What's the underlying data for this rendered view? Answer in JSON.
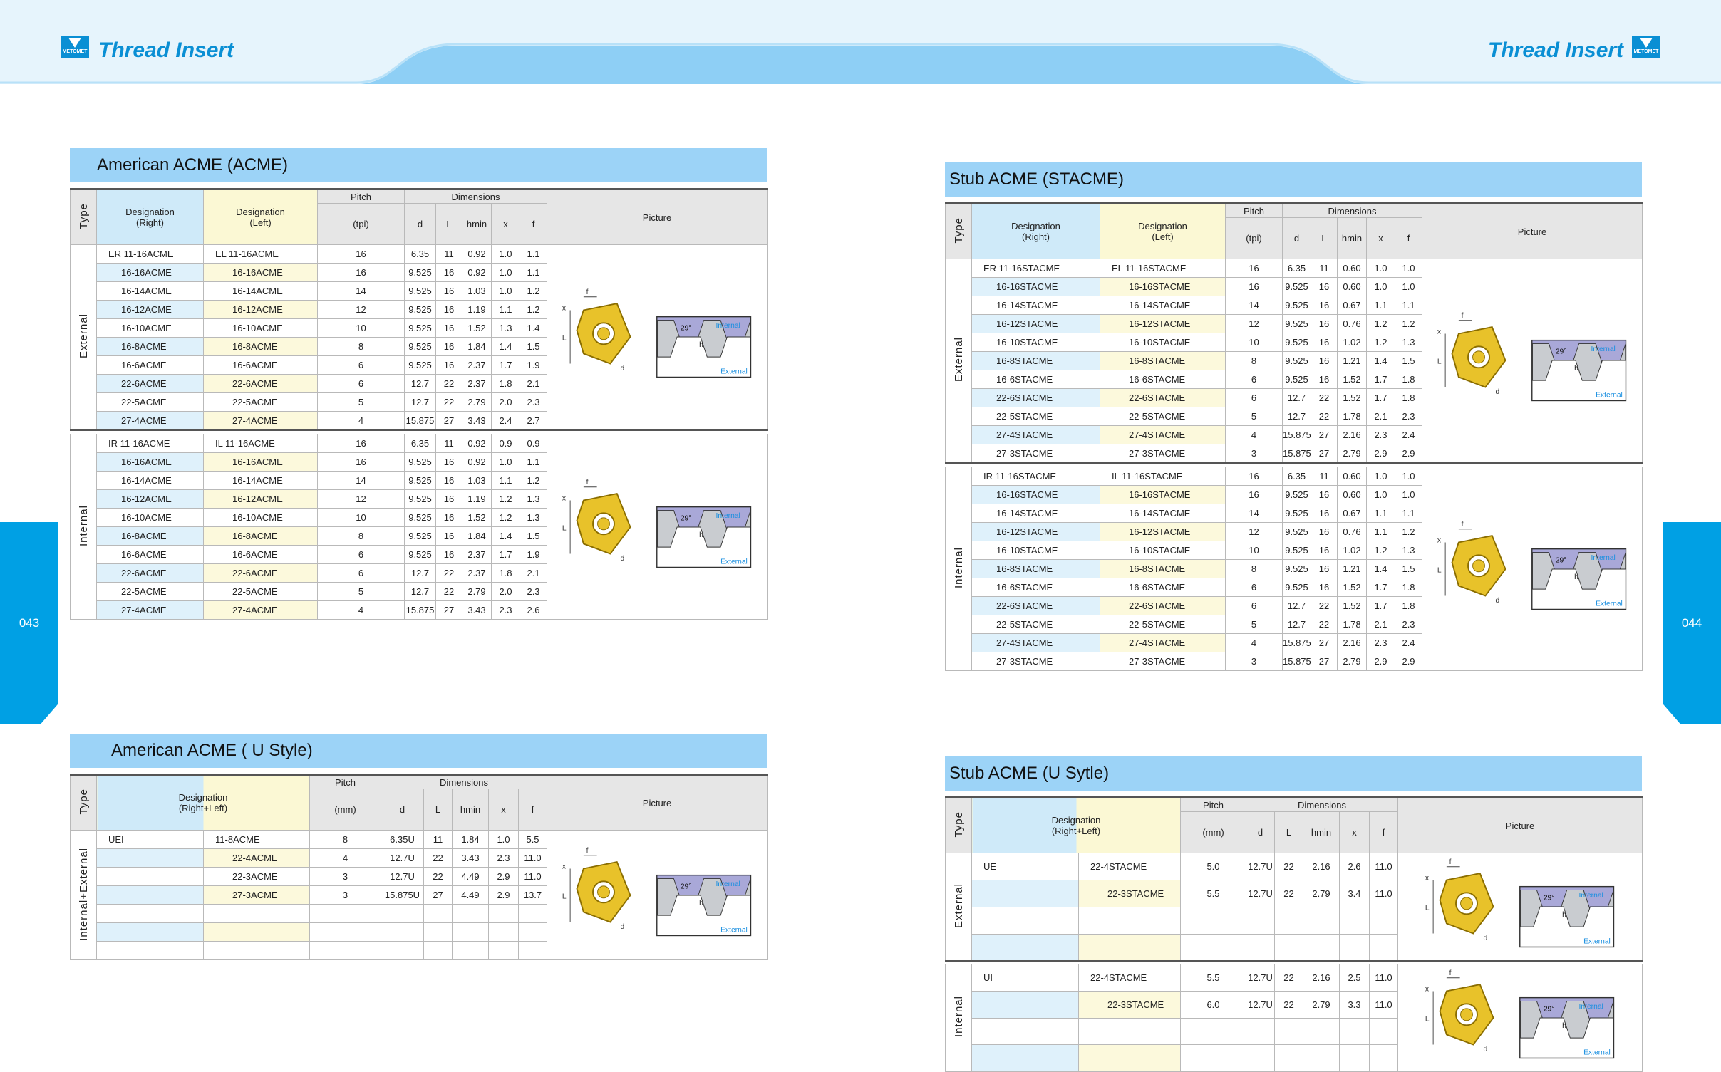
{
  "header": {
    "title_left": "Thread  Insert",
    "title_right": "Thread  Insert",
    "logo_text": "METOMET"
  },
  "side_tabs": {
    "left": "043",
    "right": "044"
  },
  "colors": {
    "accent": "#00a0e4",
    "section_header": "#9cd3f7",
    "right_col": "#dff1fb",
    "left_col": "#fcf9dc"
  },
  "labels": {
    "type": "Type",
    "des_right": "Designation\n(Right)",
    "des_left": "Designation\n(Left)",
    "des_rl": "Designation\n(Right+Left)",
    "pitch": "Pitch",
    "tpi": "(tpi)",
    "mm": "(mm)",
    "dimensions": "Dimensions",
    "d": "d",
    "L": "L",
    "hmin": "hmin",
    "x": "x",
    "f": "f",
    "picture": "Picture",
    "external": "External",
    "internal": "Internal",
    "internal_external": "Internal+External"
  },
  "acme": {
    "title": "American  ACME (ACME)",
    "external": [
      [
        "ER 11-16ACME",
        "EL 11-16ACME",
        "16",
        "6.35",
        "11",
        "0.92",
        "1.0",
        "1.1"
      ],
      [
        "16-16ACME",
        "16-16ACME",
        "16",
        "9.525",
        "16",
        "0.92",
        "1.0",
        "1.1"
      ],
      [
        "16-14ACME",
        "16-14ACME",
        "14",
        "9.525",
        "16",
        "1.03",
        "1.0",
        "1.2"
      ],
      [
        "16-12ACME",
        "16-12ACME",
        "12",
        "9.525",
        "16",
        "1.19",
        "1.1",
        "1.2"
      ],
      [
        "16-10ACME",
        "16-10ACME",
        "10",
        "9.525",
        "16",
        "1.52",
        "1.3",
        "1.4"
      ],
      [
        "16-8ACME",
        "16-8ACME",
        "8",
        "9.525",
        "16",
        "1.84",
        "1.4",
        "1.5"
      ],
      [
        "16-6ACME",
        "16-6ACME",
        "6",
        "9.525",
        "16",
        "2.37",
        "1.7",
        "1.9"
      ],
      [
        "22-6ACME",
        "22-6ACME",
        "6",
        "12.7",
        "22",
        "2.37",
        "1.8",
        "2.1"
      ],
      [
        "22-5ACME",
        "22-5ACME",
        "5",
        "12.7",
        "22",
        "2.79",
        "2.0",
        "2.3"
      ],
      [
        "27-4ACME",
        "27-4ACME",
        "4",
        "15.875",
        "27",
        "3.43",
        "2.4",
        "2.7"
      ]
    ],
    "internal": [
      [
        "IR 11-16ACME",
        "IL  11-16ACME",
        "16",
        "6.35",
        "11",
        "0.92",
        "0.9",
        "0.9"
      ],
      [
        "16-16ACME",
        "16-16ACME",
        "16",
        "9.525",
        "16",
        "0.92",
        "1.0",
        "1.1"
      ],
      [
        "16-14ACME",
        "16-14ACME",
        "14",
        "9.525",
        "16",
        "1.03",
        "1.1",
        "1.2"
      ],
      [
        "16-12ACME",
        "16-12ACME",
        "12",
        "9.525",
        "16",
        "1.19",
        "1.2",
        "1.3"
      ],
      [
        "16-10ACME",
        "16-10ACME",
        "10",
        "9.525",
        "16",
        "1.52",
        "1.2",
        "1.3"
      ],
      [
        "16-8ACME",
        "16-8ACME",
        "8",
        "9.525",
        "16",
        "1.84",
        "1.4",
        "1.5"
      ],
      [
        "16-6ACME",
        "16-6ACME",
        "6",
        "9.525",
        "16",
        "2.37",
        "1.7",
        "1.9"
      ],
      [
        "22-6ACME",
        "22-6ACME",
        "6",
        "12.7",
        "22",
        "2.37",
        "1.8",
        "2.1"
      ],
      [
        "22-5ACME",
        "22-5ACME",
        "5",
        "12.7",
        "22",
        "2.79",
        "2.0",
        "2.3"
      ],
      [
        "27-4ACME",
        "27-4ACME",
        "4",
        "15.875",
        "27",
        "3.43",
        "2.3",
        "2.6"
      ]
    ]
  },
  "acme_u": {
    "title": "American  ACME ( U Style)",
    "rows": [
      [
        "UEI",
        "11-8ACME",
        "8",
        "6.35U",
        "11",
        "1.84",
        "1.0",
        "5.5"
      ],
      [
        "",
        "22-4ACME",
        "4",
        "12.7U",
        "22",
        "3.43",
        "2.3",
        "11.0"
      ],
      [
        "",
        "22-3ACME",
        "3",
        "12.7U",
        "22",
        "4.49",
        "2.9",
        "11.0"
      ],
      [
        "",
        "27-3ACME",
        "3",
        "15.875U",
        "27",
        "4.49",
        "2.9",
        "13.7"
      ],
      [
        "",
        "",
        "",
        "",
        "",
        "",
        "",
        ""
      ],
      [
        "",
        "",
        "",
        "",
        "",
        "",
        "",
        ""
      ],
      [
        "",
        "",
        "",
        "",
        "",
        "",
        "",
        ""
      ]
    ]
  },
  "stacme": {
    "title": "Stub ACME (STACME)",
    "external": [
      [
        "ER 11-16STACME",
        "EL 11-16STACME",
        "16",
        "6.35",
        "11",
        "0.60",
        "1.0",
        "1.0"
      ],
      [
        "16-16STACME",
        "16-16STACME",
        "16",
        "9.525",
        "16",
        "0.60",
        "1.0",
        "1.0"
      ],
      [
        "16-14STACME",
        "16-14STACME",
        "14",
        "9.525",
        "16",
        "0.67",
        "1.1",
        "1.1"
      ],
      [
        "16-12STACME",
        "16-12STACME",
        "12",
        "9.525",
        "16",
        "0.76",
        "1.2",
        "1.2"
      ],
      [
        "16-10STACME",
        "16-10STACME",
        "10",
        "9.525",
        "16",
        "1.02",
        "1.2",
        "1.3"
      ],
      [
        "16-8STACME",
        "16-8STACME",
        "8",
        "9.525",
        "16",
        "1.21",
        "1.4",
        "1.5"
      ],
      [
        "16-6STACME",
        "16-6STACME",
        "6",
        "9.525",
        "16",
        "1.52",
        "1.7",
        "1.8"
      ],
      [
        "22-6STACME",
        "22-6STACME",
        "6",
        "12.7",
        "22",
        "1.52",
        "1.7",
        "1.8"
      ],
      [
        "22-5STACME",
        "22-5STACME",
        "5",
        "12.7",
        "22",
        "1.78",
        "2.1",
        "2.3"
      ],
      [
        "27-4STACME",
        "27-4STACME",
        "4",
        "15.875",
        "27",
        "2.16",
        "2.3",
        "2.4"
      ],
      [
        "27-3STACME",
        "27-3STACME",
        "3",
        "15.875",
        "27",
        "2.79",
        "2.9",
        "2.9"
      ]
    ],
    "internal": [
      [
        "IR 11-16STACME",
        "IL 11-16STACME",
        "16",
        "6.35",
        "11",
        "0.60",
        "1.0",
        "1.0"
      ],
      [
        "16-16STACME",
        "16-16STACME",
        "16",
        "9.525",
        "16",
        "0.60",
        "1.0",
        "1.0"
      ],
      [
        "16-14STACME",
        "16-14STACME",
        "14",
        "9.525",
        "16",
        "0.67",
        "1.1",
        "1.1"
      ],
      [
        "16-12STACME",
        "16-12STACME",
        "12",
        "9.525",
        "16",
        "0.76",
        "1.1",
        "1.2"
      ],
      [
        "16-10STACME",
        "16-10STACME",
        "10",
        "9.525",
        "16",
        "1.02",
        "1.2",
        "1.3"
      ],
      [
        "16-8STACME",
        "16-8STACME",
        "8",
        "9.525",
        "16",
        "1.21",
        "1.4",
        "1.5"
      ],
      [
        "16-6STACME",
        "16-6STACME",
        "6",
        "9.525",
        "16",
        "1.52",
        "1.7",
        "1.8"
      ],
      [
        "22-6STACME",
        "22-6STACME",
        "6",
        "12.7",
        "22",
        "1.52",
        "1.7",
        "1.8"
      ],
      [
        "22-5STACME",
        "22-5STACME",
        "5",
        "12.7",
        "22",
        "1.78",
        "2.1",
        "2.3"
      ],
      [
        "27-4STACME",
        "27-4STACME",
        "4",
        "15.875",
        "27",
        "2.16",
        "2.3",
        "2.4"
      ],
      [
        "27-3STACME",
        "27-3STACME",
        "3",
        "15.875",
        "27",
        "2.79",
        "2.9",
        "2.9"
      ]
    ]
  },
  "stacme_u": {
    "title": "Stub ACME (U Sytle)",
    "external": [
      [
        "UE",
        "22-4STACME",
        "5.0",
        "12.7U",
        "22",
        "2.16",
        "2.6",
        "11.0"
      ],
      [
        "",
        "22-3STACME",
        "5.5",
        "12.7U",
        "22",
        "2.79",
        "3.4",
        "11.0"
      ],
      [
        "",
        "",
        "",
        "",
        "",
        "",
        "",
        ""
      ],
      [
        "",
        "",
        "",
        "",
        "",
        "",
        "",
        ""
      ]
    ],
    "internal": [
      [
        "UI",
        "22-4STACME",
        "5.5",
        "12.7U",
        "22",
        "2.16",
        "2.5",
        "11.0"
      ],
      [
        "",
        "22-3STACME",
        "6.0",
        "12.7U",
        "22",
        "2.79",
        "3.3",
        "11.0"
      ],
      [
        "",
        "",
        "",
        "",
        "",
        "",
        "",
        ""
      ],
      [
        "",
        "",
        "",
        "",
        "",
        "",
        "",
        ""
      ]
    ]
  },
  "diagram": {
    "angle": "29°",
    "internal": "Internal",
    "external": "External",
    "x": "x",
    "f": "f",
    "L": "L",
    "d": "d",
    "h": "h"
  }
}
